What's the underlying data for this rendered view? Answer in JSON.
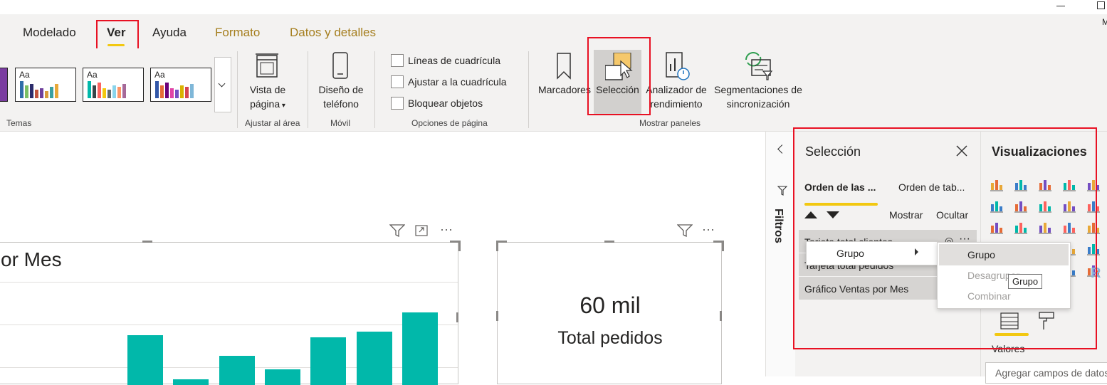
{
  "ribbon": {
    "tabs": [
      {
        "label": "Modelado"
      },
      {
        "label": "Ver"
      },
      {
        "label": "Ayuda"
      },
      {
        "label": "Formato"
      },
      {
        "label": "Datos y detalles"
      }
    ],
    "groups": {
      "temas": "Temas",
      "ajustar": "Ajustar al área",
      "movil": "Móvil",
      "opciones": "Opciones de página",
      "mostrar": "Mostrar paneles"
    },
    "theme_thumb_text": "Aa",
    "vista_pagina": {
      "line1": "Vista de",
      "line2": "página"
    },
    "diseno_telefono": {
      "line1": "Diseño de",
      "line2": "teléfono"
    },
    "checkboxes": [
      {
        "label": "Líneas de cuadrícula"
      },
      {
        "label": "Ajustar a la cuadrícula"
      },
      {
        "label": "Bloquear objetos"
      }
    ],
    "marcadores": "Marcadores",
    "seleccion": "Selección",
    "analizador": {
      "line1": "Analizador de",
      "line2": "rendimiento"
    },
    "segmentaciones": {
      "line1": "Segmentaciones de",
      "line2": "sincronización"
    }
  },
  "canvas": {
    "chart_title_fragment": "or Mes",
    "card_value": "60 mil",
    "card_label": "Total pedidos",
    "chart_data": {
      "type": "bar",
      "categories": [
        "",
        "",
        "",
        "",
        "",
        "",
        ""
      ],
      "values": [
        69,
        8,
        40,
        22,
        66,
        74,
        100
      ],
      "title": "",
      "xlabel": "",
      "ylabel": ""
    }
  },
  "filters": {
    "label": "Filtros"
  },
  "selection_pane": {
    "title": "Selección",
    "tab_layer_order": "Orden de las ...",
    "tab_tab_order": "Orden de tab...",
    "show": "Mostrar",
    "hide": "Ocultar",
    "items": [
      {
        "label": "Tarjeta total clientes"
      },
      {
        "label": "Tarjeta total pedidos"
      },
      {
        "label": "Gráfico Ventas por Mes"
      }
    ]
  },
  "context_menu": {
    "grupo": "Grupo",
    "submenu": {
      "grupo": "Grupo",
      "desagrupar": "Desagrupar",
      "combinar": "Combinar"
    },
    "tooltip": "Grupo"
  },
  "visualizations_pane": {
    "title": "Visualizaciones",
    "valores": "Valores",
    "add_fields_placeholder": "Agregar campos de datos",
    "r_visual": "R"
  },
  "colors": {
    "accent_yellow": "#f2c811",
    "teal_bar": "#01b8aa",
    "highlight_red": "#e81123"
  }
}
